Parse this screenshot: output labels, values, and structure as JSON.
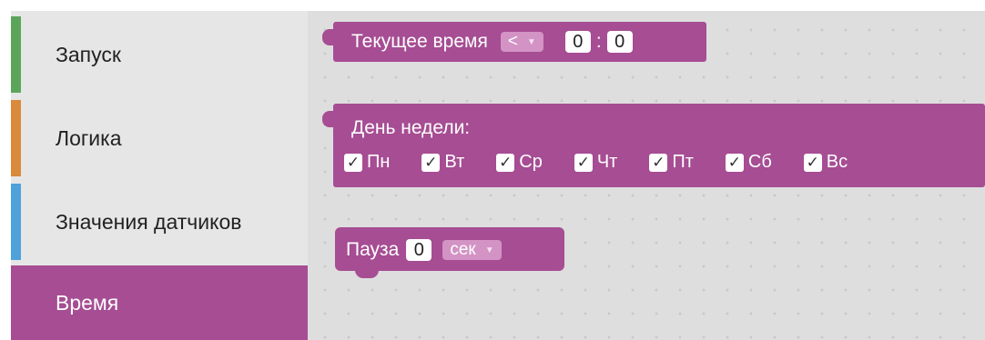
{
  "sidebar": {
    "categories": [
      {
        "label": "Запуск",
        "color": "#5ba55b"
      },
      {
        "label": "Логика",
        "color": "#d98a3a"
      },
      {
        "label": "Значения датчиков",
        "color": "#4fa2d9"
      },
      {
        "label": "Время",
        "color": "#a64d93",
        "selected": true
      }
    ]
  },
  "blocks": {
    "current_time": {
      "label": "Текущее время",
      "operator": "<",
      "hours": "0",
      "separator": ":",
      "minutes": "0"
    },
    "weekday": {
      "label": "День недели:",
      "check_mark": "✓",
      "days": [
        {
          "label": "Пн",
          "checked": true
        },
        {
          "label": "Вт",
          "checked": true
        },
        {
          "label": "Ср",
          "checked": true
        },
        {
          "label": "Чт",
          "checked": true
        },
        {
          "label": "Пт",
          "checked": true
        },
        {
          "label": "Сб",
          "checked": true
        },
        {
          "label": "Вс",
          "checked": true
        }
      ]
    },
    "pause": {
      "label": "Пауза",
      "value": "0",
      "unit": "сек"
    }
  },
  "colors": {
    "block": "#a64d93",
    "dropdown": "#d393c4",
    "workspace": "#dedede",
    "sidebar": "#e6e6e6"
  }
}
